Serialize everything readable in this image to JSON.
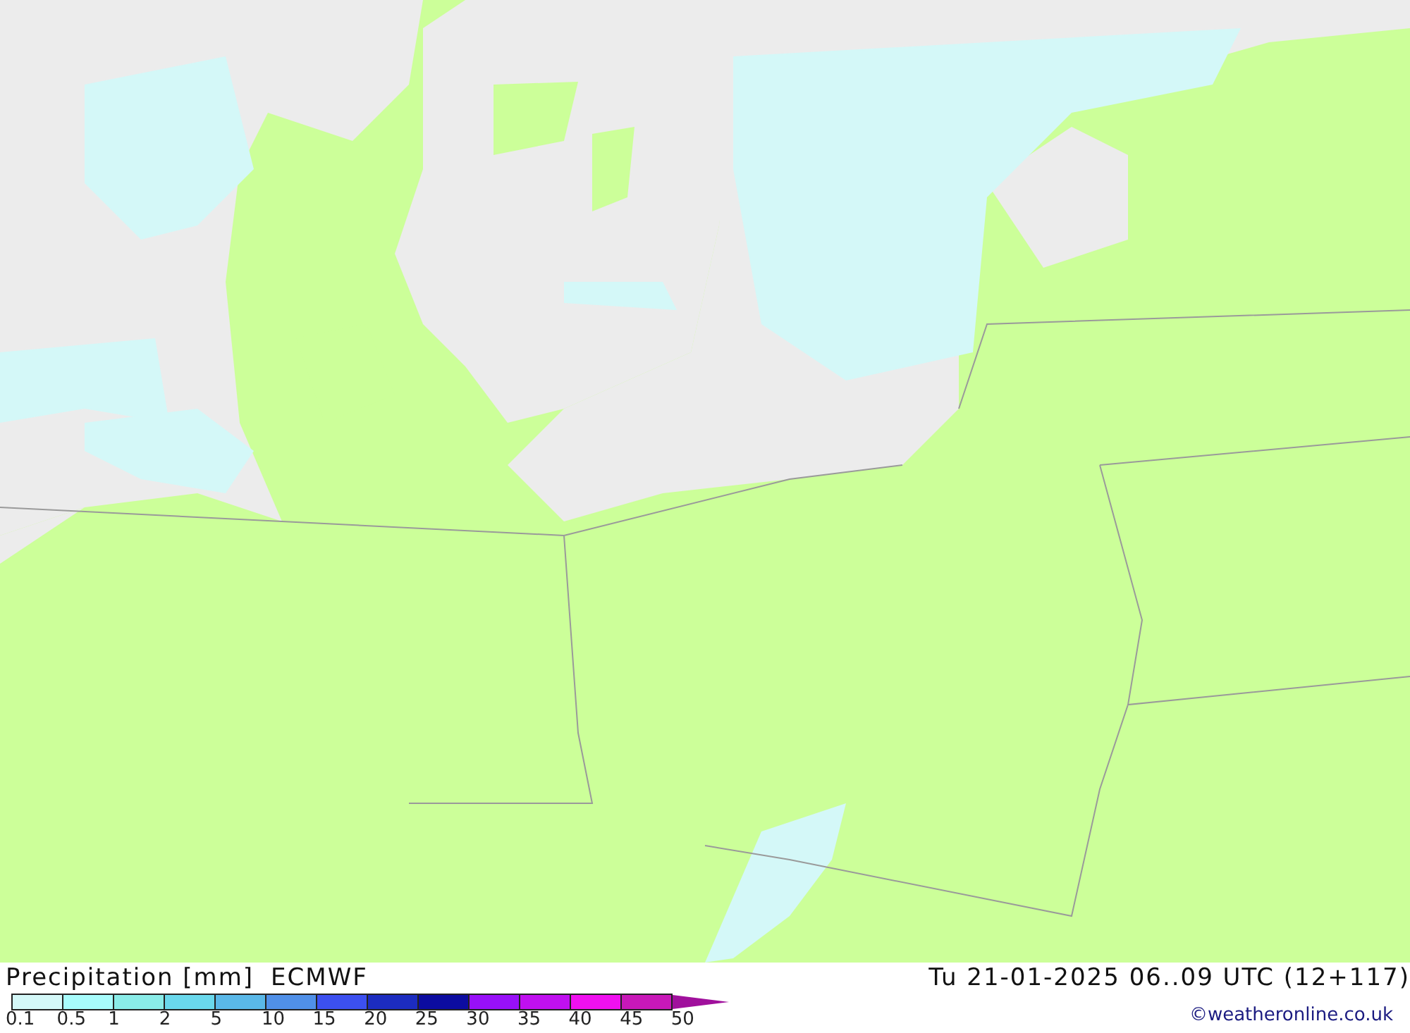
{
  "title": "Precipitation [mm]",
  "model": "ECMWF",
  "valid_time": "Tu 21-01-2025 06..09 UTC (12+117)",
  "legend": [
    {
      "label": "0.1",
      "color": "#d4f8f8"
    },
    {
      "label": "0.5",
      "color": "#a8fcfc"
    },
    {
      "label": "1",
      "color": "#8aece8"
    },
    {
      "label": "2",
      "color": "#6ad8ec"
    },
    {
      "label": "5",
      "color": "#5ab8e8"
    },
    {
      "label": "10",
      "color": "#5090e8"
    },
    {
      "label": "15",
      "color": "#3c50f0"
    },
    {
      "label": "20",
      "color": "#1c2cc0"
    },
    {
      "label": "25",
      "color": "#0c0ca0"
    },
    {
      "label": "30",
      "color": "#9810f8"
    },
    {
      "label": "35",
      "color": "#c010f0"
    },
    {
      "label": "40",
      "color": "#f010f0"
    },
    {
      "label": "45",
      "color": "#c818b8"
    },
    {
      "label": "50",
      "color": "#a0109c"
    }
  ],
  "credit": "©weatheronline.co.uk"
}
